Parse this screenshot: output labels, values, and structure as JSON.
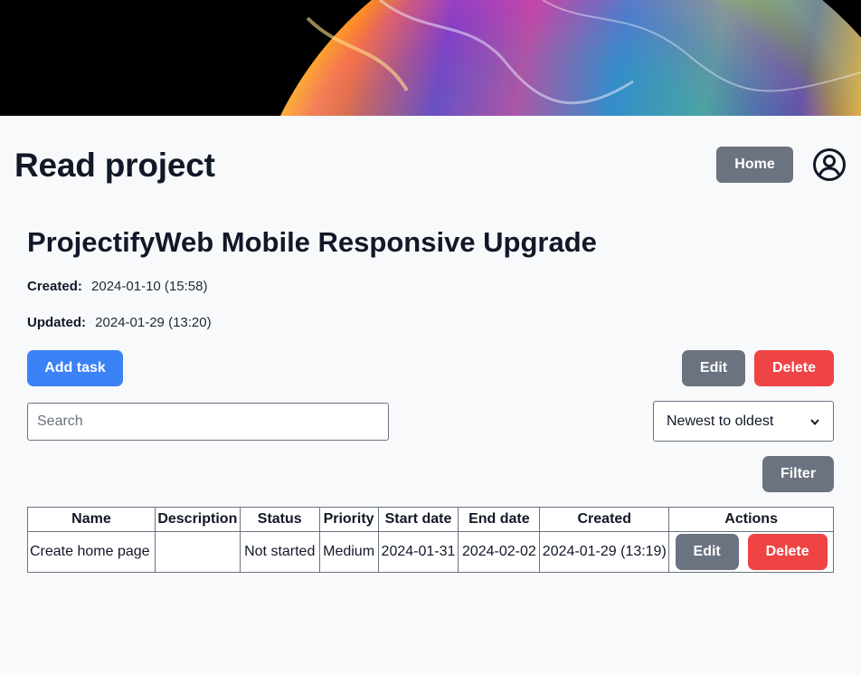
{
  "header": {
    "banner_icon": "soap-bubble-banner-image",
    "page_title": "Read project",
    "home_label": "Home",
    "user_icon": "user-circle-icon"
  },
  "project": {
    "title": "ProjectifyWeb Mobile Responsive Upgrade",
    "created_label": "Created:",
    "created_value": "2024-01-10 (15:58)",
    "updated_label": "Updated:",
    "updated_value": "2024-01-29 (13:20)"
  },
  "actions": {
    "add_task": "Add task",
    "edit": "Edit",
    "delete": "Delete"
  },
  "search": {
    "placeholder": "Search",
    "value": ""
  },
  "sort": {
    "selected": "Newest to oldest"
  },
  "filter_label": "Filter",
  "table": {
    "columns": [
      "Name",
      "Description",
      "Status",
      "Priority",
      "Start date",
      "End date",
      "Created",
      "Actions"
    ],
    "rows": [
      {
        "name": "Create home page",
        "description": "",
        "status": "Not started",
        "priority": "Medium",
        "start_date": "2024-01-31",
        "end_date": "2024-02-02",
        "created": "2024-01-29 (13:19)",
        "edit_label": "Edit",
        "delete_label": "Delete"
      }
    ]
  },
  "colors": {
    "primary": "#3b82f6",
    "secondary": "#6b7280",
    "danger": "#ef4444",
    "background": "#f8f9fb"
  }
}
